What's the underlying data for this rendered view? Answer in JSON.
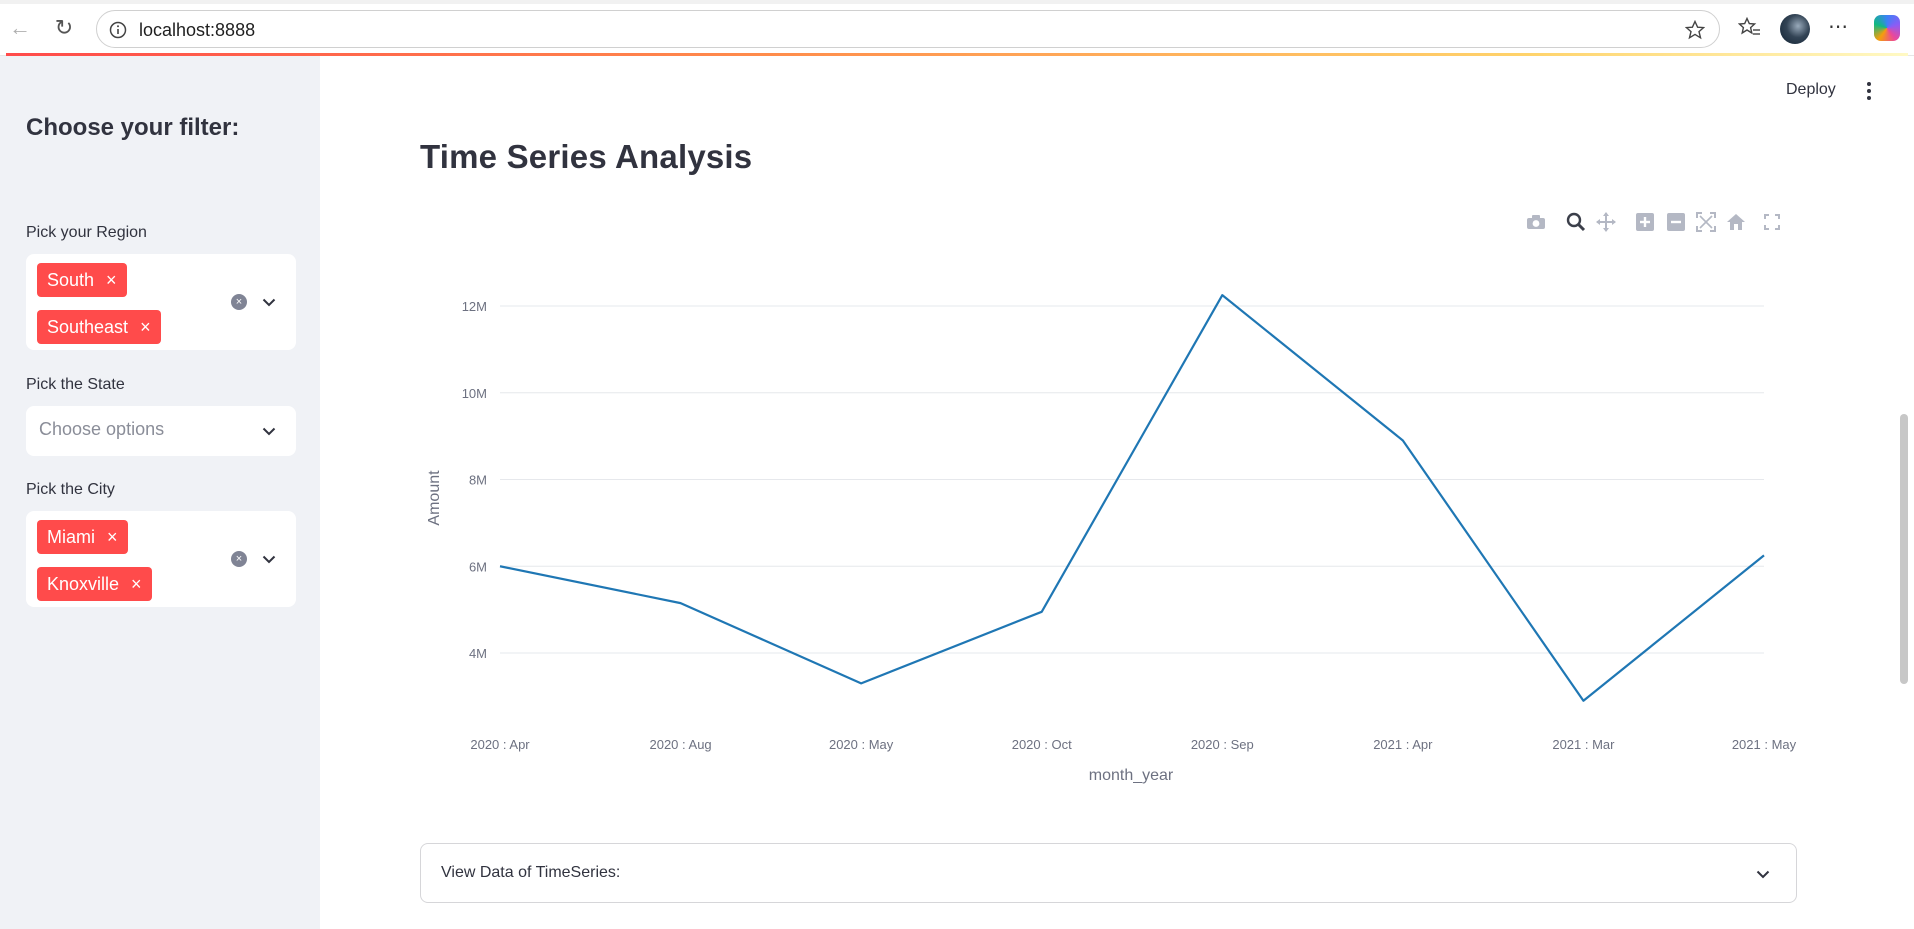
{
  "browser": {
    "url": "localhost:8888"
  },
  "sidebar": {
    "title": "Choose your filter:",
    "region": {
      "label": "Pick your Region",
      "chips": [
        "South",
        "Southeast"
      ]
    },
    "state": {
      "label": "Pick the State",
      "placeholder": "Choose options"
    },
    "city": {
      "label": "Pick the City",
      "chips": [
        "Miami",
        "Knoxville"
      ]
    }
  },
  "header": {
    "deploy_label": "Deploy"
  },
  "main": {
    "title": "Time Series Analysis",
    "expander_label": "View Data of TimeSeries:"
  },
  "colors": {
    "accent": "#ff4b4b",
    "line": "#1f77b4",
    "sidebar_bg": "#f0f2f6"
  },
  "chart_data": {
    "type": "line",
    "x": [
      "2020 : Apr",
      "2020 : Aug",
      "2020 : May",
      "2020 : Oct",
      "2020 : Sep",
      "2021 : Apr",
      "2021 : Mar",
      "2021 : May"
    ],
    "series": [
      {
        "values": [
          6000000,
          5150000,
          3300000,
          4950000,
          12250000,
          8900000,
          2900000,
          6250000
        ]
      }
    ],
    "xlabel": "month_year",
    "ylabel": "Amount",
    "yticks": [
      "4M",
      "6M",
      "8M",
      "10M",
      "12M"
    ],
    "ytick_values": [
      4000000,
      6000000,
      8000000,
      10000000,
      12000000
    ],
    "grid": true
  }
}
